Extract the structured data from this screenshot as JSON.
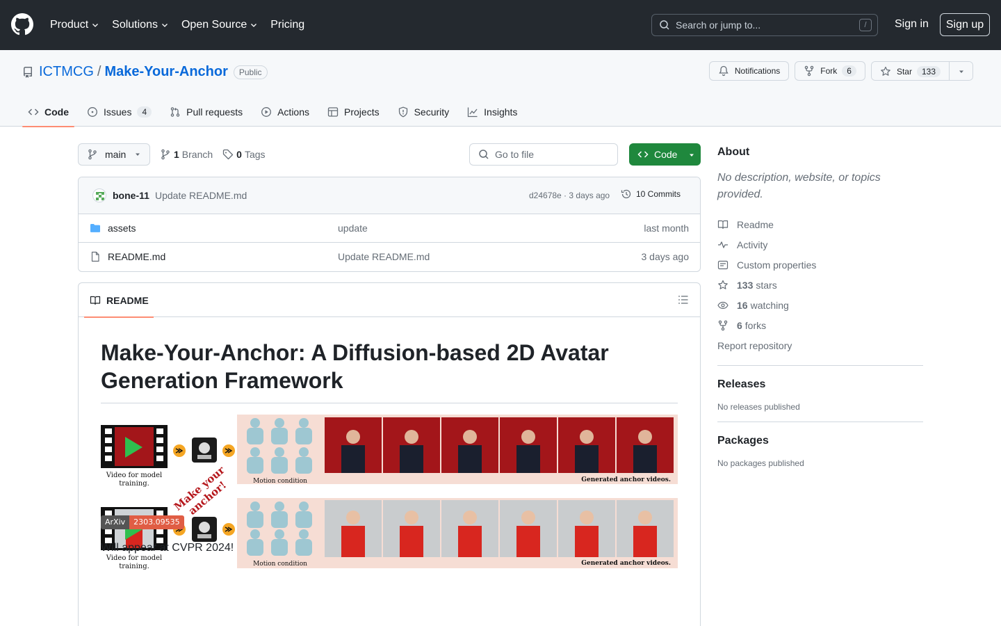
{
  "header": {
    "nav": [
      "Product",
      "Solutions",
      "Open Source",
      "Pricing"
    ],
    "search_placeholder": "Search or jump to...",
    "search_key": "/",
    "signin": "Sign in",
    "signup": "Sign up"
  },
  "repo": {
    "owner": "ICTMCG",
    "separator": "/",
    "name": "Make-Your-Anchor",
    "visibility": "Public",
    "notifications_label": "Notifications",
    "fork_label": "Fork",
    "fork_count": "6",
    "star_label": "Star",
    "star_count": "133",
    "tabs": [
      {
        "label": "Code"
      },
      {
        "label": "Issues",
        "count": "4"
      },
      {
        "label": "Pull requests"
      },
      {
        "label": "Actions"
      },
      {
        "label": "Projects"
      },
      {
        "label": "Security"
      },
      {
        "label": "Insights"
      }
    ]
  },
  "files": {
    "branch": "main",
    "branch_count": "1",
    "branch_word": "Branch",
    "tag_count": "0",
    "tag_word": "Tags",
    "goto_placeholder": "Go to file",
    "code_button": "Code",
    "commit": {
      "author": "bone-11",
      "message": "Update README.md",
      "meta": "d24678e · 3 days ago",
      "count": "10 Commits"
    },
    "rows": [
      {
        "name": "assets",
        "message": "update",
        "time": "last month"
      },
      {
        "name": "README.md",
        "message": "Update README.md",
        "time": "3 days ago"
      }
    ]
  },
  "readme": {
    "tab": "README",
    "title": "Make-Your-Anchor: A Diffusion-based 2D Avatar Generation Framework",
    "figure": {
      "video_caption_line1": "Video for model",
      "video_caption_line2": "training.",
      "motion_label": "Motion condition",
      "generated_label": "Generated anchor videos.",
      "diagonal_line1": "Make your",
      "diagonal_line2": "anchor!"
    },
    "badge_left": "ArXiv",
    "badge_right": "2303.09535",
    "paragraph": "Will appear at CVPR 2024!"
  },
  "sidebar": {
    "about_title": "About",
    "about_desc": "No description, website, or topics provided.",
    "links": {
      "readme": "Readme",
      "activity": "Activity",
      "custom": "Custom properties",
      "stars_count": "133",
      "stars_word": "stars",
      "watching_count": "16",
      "watching_word": "watching",
      "forks_count": "6",
      "forks_word": "forks",
      "report": "Report repository"
    },
    "releases_title": "Releases",
    "releases_sub": "No releases published",
    "packages_title": "Packages",
    "packages_sub": "No packages published"
  },
  "colors": {
    "header_bg": "#24292f",
    "link": "#0969da",
    "green": "#1f883d",
    "tab_underline": "#fd8c73",
    "figure_panel": "#f6ddd4",
    "figure_red_bg": "#a3161a",
    "figure_arrow": "#f5a623"
  }
}
